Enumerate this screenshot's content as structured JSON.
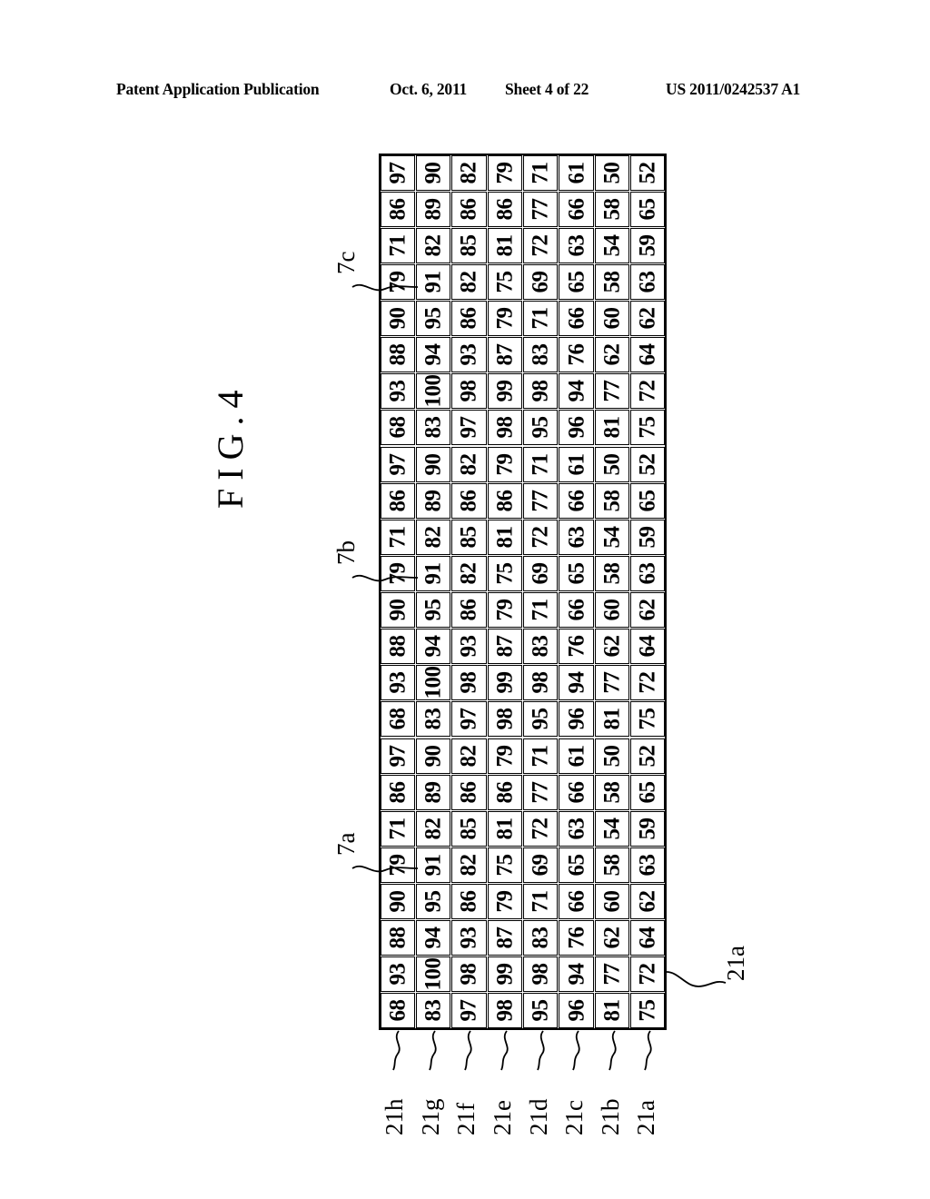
{
  "header": {
    "publication": "Patent Application Publication",
    "date": "Oct. 6, 2011",
    "sheet": "Sheet 4 of 22",
    "doc_number": "US 2011/0242537 A1"
  },
  "figure": {
    "title": "FIG.4"
  },
  "chart_data": {
    "type": "table",
    "title": "FIG.4",
    "orientation": "rotated-90-ccw",
    "rows": 24,
    "columns": 8,
    "column_labels": [
      "21h",
      "21g",
      "21f",
      "21e",
      "21d",
      "21c",
      "21b",
      "21a"
    ],
    "block_labels": [
      "7c",
      "7b",
      "7a"
    ],
    "values": [
      [
        97,
        90,
        82,
        79,
        71,
        61,
        50,
        52
      ],
      [
        86,
        89,
        86,
        86,
        77,
        66,
        58,
        65
      ],
      [
        71,
        82,
        85,
        81,
        72,
        63,
        54,
        59
      ],
      [
        79,
        91,
        82,
        75,
        69,
        65,
        58,
        63
      ],
      [
        90,
        95,
        86,
        79,
        71,
        66,
        60,
        62
      ],
      [
        88,
        94,
        93,
        87,
        83,
        76,
        62,
        64
      ],
      [
        93,
        100,
        98,
        99,
        98,
        94,
        77,
        72
      ],
      [
        68,
        83,
        97,
        98,
        95,
        96,
        81,
        75
      ],
      [
        97,
        90,
        82,
        79,
        71,
        61,
        50,
        52
      ],
      [
        86,
        89,
        86,
        86,
        77,
        66,
        58,
        65
      ],
      [
        71,
        82,
        85,
        81,
        72,
        63,
        54,
        59
      ],
      [
        79,
        91,
        82,
        75,
        69,
        65,
        58,
        63
      ],
      [
        90,
        95,
        86,
        79,
        71,
        66,
        60,
        62
      ],
      [
        88,
        94,
        93,
        87,
        83,
        76,
        62,
        64
      ],
      [
        93,
        100,
        98,
        99,
        98,
        94,
        77,
        72
      ],
      [
        68,
        83,
        97,
        98,
        95,
        96,
        81,
        75
      ],
      [
        97,
        90,
        82,
        79,
        71,
        61,
        50,
        52
      ],
      [
        86,
        89,
        86,
        86,
        77,
        66,
        58,
        65
      ],
      [
        71,
        82,
        85,
        81,
        72,
        63,
        54,
        59
      ],
      [
        79,
        91,
        82,
        75,
        69,
        65,
        58,
        63
      ],
      [
        90,
        95,
        86,
        79,
        71,
        66,
        60,
        62
      ],
      [
        88,
        94,
        93,
        87,
        83,
        76,
        62,
        64
      ],
      [
        93,
        100,
        98,
        99,
        98,
        94,
        77,
        72
      ],
      [
        68,
        83,
        97,
        98,
        95,
        96,
        81,
        75
      ]
    ]
  },
  "callouts": {
    "block": [
      {
        "label": "7c"
      },
      {
        "label": "7b"
      },
      {
        "label": "7a"
      }
    ],
    "right": {
      "label": "21a"
    },
    "bottom": [
      "21h",
      "21g",
      "21f",
      "21e",
      "21d",
      "21c",
      "21b",
      "21a"
    ]
  }
}
